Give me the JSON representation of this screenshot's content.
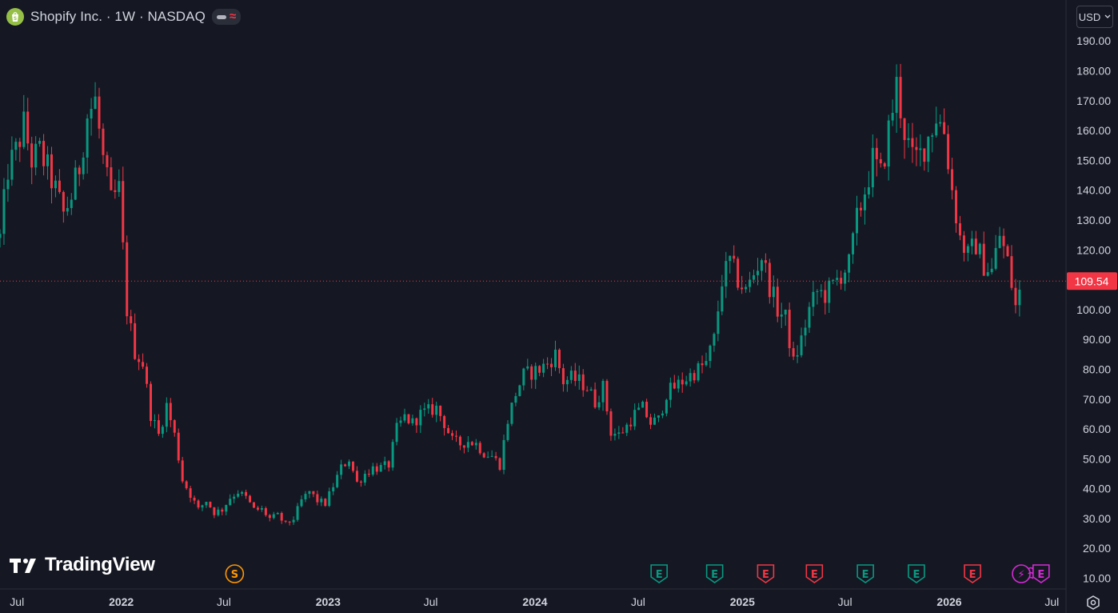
{
  "header": {
    "title": "Shopify Inc. · 1W · NASDAQ",
    "logo_icon": "shopify-bag-icon",
    "status_wave": "≈"
  },
  "currency": {
    "label": "USD"
  },
  "brand": {
    "name": "TradingView"
  },
  "colors": {
    "up": "#089981",
    "down": "#f23645",
    "background": "#151823",
    "axis_text": "#d1d4dc",
    "earnings_purple": "#d62ad6"
  },
  "chart_data": {
    "type": "candlestick",
    "title": "Shopify Inc. · 1W · NASDAQ",
    "x_range": [
      "2021-06-01",
      "2026-07-26"
    ],
    "ylim": [
      8,
      193
    ],
    "y_ticks": [
      10,
      20,
      30,
      40,
      50,
      60,
      70,
      80,
      90,
      100,
      110,
      120,
      130,
      140,
      150,
      160,
      170,
      180,
      190
    ],
    "y_tick_labels": [
      "10.00",
      "20.00",
      "30.00",
      "40.00",
      "50.00",
      "60.00",
      "70.00",
      "80.00",
      "90.00",
      "100.00",
      "110.00",
      "120.00",
      "130.00",
      "140.00",
      "150.00",
      "160.00",
      "170.00",
      "180.00",
      "190.00"
    ],
    "x_ticks": [
      {
        "date": "2021-07-01",
        "label": "Jul",
        "bold": false
      },
      {
        "date": "2022-01-01",
        "label": "2022",
        "bold": true
      },
      {
        "date": "2022-07-01",
        "label": "Jul",
        "bold": false
      },
      {
        "date": "2023-01-01",
        "label": "2023",
        "bold": true
      },
      {
        "date": "2023-07-01",
        "label": "Jul",
        "bold": false
      },
      {
        "date": "2024-01-01",
        "label": "2024",
        "bold": true
      },
      {
        "date": "2024-07-01",
        "label": "Jul",
        "bold": false
      },
      {
        "date": "2025-01-01",
        "label": "2025",
        "bold": true
      },
      {
        "date": "2025-07-01",
        "label": "Jul",
        "bold": false
      },
      {
        "date": "2026-01-01",
        "label": "2026",
        "bold": true
      },
      {
        "date": "2026-07-01",
        "label": "Jul",
        "bold": false
      }
    ],
    "last_price": 109.54,
    "last_price_label": "109.54",
    "closes": [
      [
        "2021-06-01",
        124
      ],
      [
        "2021-06-15",
        147
      ],
      [
        "2021-06-29",
        153
      ],
      [
        "2021-07-13",
        162
      ],
      [
        "2021-07-27",
        150
      ],
      [
        "2021-08-10",
        153
      ],
      [
        "2021-08-24",
        147
      ],
      [
        "2021-09-07",
        140
      ],
      [
        "2021-09-21",
        132
      ],
      [
        "2021-10-05",
        138
      ],
      [
        "2021-10-19",
        148
      ],
      [
        "2021-11-02",
        165
      ],
      [
        "2021-11-16",
        170
      ],
      [
        "2021-11-30",
        150
      ],
      [
        "2021-12-14",
        136
      ],
      [
        "2021-12-28",
        140
      ],
      [
        "2022-01-11",
        100
      ],
      [
        "2022-01-25",
        86
      ],
      [
        "2022-02-08",
        82
      ],
      [
        "2022-02-22",
        65
      ],
      [
        "2022-03-08",
        58
      ],
      [
        "2022-03-22",
        68
      ],
      [
        "2022-04-05",
        58
      ],
      [
        "2022-04-19",
        43
      ],
      [
        "2022-05-03",
        38
      ],
      [
        "2022-05-17",
        33
      ],
      [
        "2022-05-31",
        36
      ],
      [
        "2022-06-14",
        32
      ],
      [
        "2022-06-28",
        33
      ],
      [
        "2022-07-12",
        37
      ],
      [
        "2022-07-26",
        39
      ],
      [
        "2022-08-09",
        37
      ],
      [
        "2022-08-23",
        33
      ],
      [
        "2022-09-06",
        33
      ],
      [
        "2022-09-20",
        30
      ],
      [
        "2022-10-04",
        31
      ],
      [
        "2022-10-18",
        28
      ],
      [
        "2022-11-01",
        30
      ],
      [
        "2022-11-15",
        36
      ],
      [
        "2022-11-29",
        39
      ],
      [
        "2022-12-13",
        36
      ],
      [
        "2022-12-27",
        35
      ],
      [
        "2023-01-10",
        41
      ],
      [
        "2023-01-24",
        47
      ],
      [
        "2023-02-07",
        50
      ],
      [
        "2023-02-21",
        42
      ],
      [
        "2023-03-07",
        45
      ],
      [
        "2023-03-21",
        47
      ],
      [
        "2023-04-04",
        47
      ],
      [
        "2023-04-18",
        48
      ],
      [
        "2023-05-02",
        60
      ],
      [
        "2023-05-16",
        64
      ],
      [
        "2023-05-30",
        62
      ],
      [
        "2023-06-13",
        65
      ],
      [
        "2023-06-27",
        66
      ],
      [
        "2023-07-11",
        67
      ],
      [
        "2023-07-25",
        62
      ],
      [
        "2023-08-08",
        56
      ],
      [
        "2023-08-22",
        55
      ],
      [
        "2023-09-05",
        56
      ],
      [
        "2023-09-19",
        55
      ],
      [
        "2023-10-03",
        52
      ],
      [
        "2023-10-17",
        51
      ],
      [
        "2023-10-31",
        48
      ],
      [
        "2023-11-14",
        63
      ],
      [
        "2023-11-28",
        72
      ],
      [
        "2023-12-12",
        78
      ],
      [
        "2023-12-26",
        79
      ],
      [
        "2024-01-09",
        80
      ],
      [
        "2024-01-23",
        82
      ],
      [
        "2024-02-06",
        85
      ],
      [
        "2024-02-20",
        76
      ],
      [
        "2024-03-05",
        77
      ],
      [
        "2024-03-19",
        76
      ],
      [
        "2024-04-02",
        74
      ],
      [
        "2024-04-16",
        69
      ],
      [
        "2024-04-30",
        74
      ],
      [
        "2024-05-14",
        59
      ],
      [
        "2024-05-28",
        58
      ],
      [
        "2024-06-11",
        61
      ],
      [
        "2024-06-25",
        65
      ],
      [
        "2024-07-09",
        67
      ],
      [
        "2024-07-23",
        62
      ],
      [
        "2024-08-06",
        63
      ],
      [
        "2024-08-20",
        72
      ],
      [
        "2024-09-03",
        74
      ],
      [
        "2024-09-17",
        76
      ],
      [
        "2024-10-01",
        78
      ],
      [
        "2024-10-15",
        80
      ],
      [
        "2024-10-29",
        82
      ],
      [
        "2024-11-12",
        90
      ],
      [
        "2024-11-26",
        110
      ],
      [
        "2024-12-10",
        116
      ],
      [
        "2024-12-24",
        110
      ],
      [
        "2025-01-07",
        106
      ],
      [
        "2025-01-21",
        112
      ],
      [
        "2025-02-04",
        118
      ],
      [
        "2025-02-18",
        108
      ],
      [
        "2025-03-04",
        100
      ],
      [
        "2025-03-18",
        97
      ],
      [
        "2025-04-01",
        82
      ],
      [
        "2025-04-15",
        90
      ],
      [
        "2025-04-29",
        100
      ],
      [
        "2025-05-13",
        106
      ],
      [
        "2025-05-27",
        105
      ],
      [
        "2025-06-10",
        108
      ],
      [
        "2025-06-24",
        112
      ],
      [
        "2025-07-08",
        115
      ],
      [
        "2025-07-22",
        130
      ],
      [
        "2025-08-05",
        140
      ],
      [
        "2025-08-19",
        150
      ],
      [
        "2025-09-02",
        145
      ],
      [
        "2025-09-16",
        160
      ],
      [
        "2025-09-30",
        175
      ],
      [
        "2025-10-14",
        160
      ],
      [
        "2025-10-28",
        150
      ],
      [
        "2025-11-11",
        152
      ],
      [
        "2025-11-25",
        158
      ],
      [
        "2025-12-09",
        165
      ],
      [
        "2025-12-23",
        160
      ],
      [
        "2026-01-06",
        140
      ],
      [
        "2026-01-20",
        124
      ],
      [
        "2026-02-03",
        118
      ],
      [
        "2026-02-17",
        122
      ],
      [
        "2026-03-03",
        115
      ],
      [
        "2026-03-17",
        113
      ],
      [
        "2026-03-31",
        125
      ],
      [
        "2026-04-14",
        116
      ],
      [
        "2026-04-28",
        101
      ],
      [
        "2026-05-12",
        110
      ]
    ],
    "event_markers": [
      {
        "date": "2022-07-20",
        "label": "S",
        "kind": "split",
        "color": "#ff9800"
      },
      {
        "date": "2024-08-07",
        "label": "E",
        "kind": "earnings",
        "color": "#089981"
      },
      {
        "date": "2024-11-13",
        "label": "E",
        "kind": "earnings",
        "color": "#089981"
      },
      {
        "date": "2025-02-11",
        "label": "E",
        "kind": "earnings",
        "color": "#f23645"
      },
      {
        "date": "2025-05-08",
        "label": "E",
        "kind": "earnings",
        "color": "#f23645"
      },
      {
        "date": "2025-08-06",
        "label": "E",
        "kind": "earnings",
        "color": "#089981"
      },
      {
        "date": "2025-11-04",
        "label": "E",
        "kind": "earnings",
        "color": "#089981"
      },
      {
        "date": "2026-02-11",
        "label": "E",
        "kind": "earnings",
        "color": "#f23645"
      },
      {
        "date": "2026-05-08",
        "label": "⚡",
        "kind": "news",
        "color": "#d62ad6"
      },
      {
        "date": "2026-06-12",
        "label": "E",
        "kind": "earnings-upcoming",
        "color": "#d62ad6"
      }
    ]
  }
}
